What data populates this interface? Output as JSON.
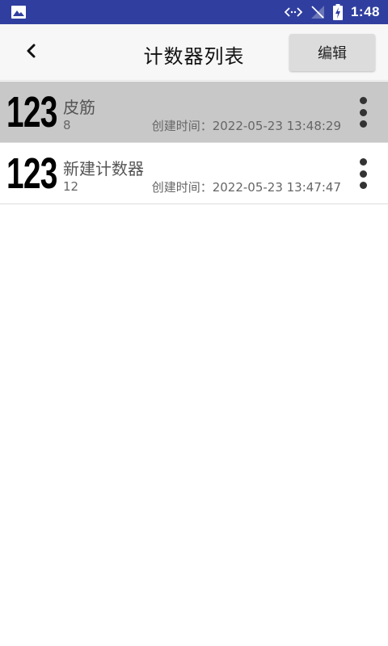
{
  "status_bar": {
    "time": "1:48",
    "icons": [
      "image-icon",
      "data-arrows-icon",
      "no-signal-icon",
      "battery-charging-icon"
    ]
  },
  "app_bar": {
    "back_icon": "chevron-left-icon",
    "title": "计数器列表",
    "edit_label": "编辑"
  },
  "counters": [
    {
      "icon_text": "123",
      "name": "皮筋",
      "count": "8",
      "created": "创建时间：2022-05-23 13:48:29",
      "selected": true
    },
    {
      "icon_text": "123",
      "name": "新建计数器",
      "count": "12",
      "created": "创建时间：2022-05-23 13:47:47",
      "selected": false
    }
  ],
  "colors": {
    "status_bar": "#303f9f",
    "app_bar": "#f7f7f7",
    "selected_row": "#c8c8c8",
    "edit_button": "#dcdcdc"
  }
}
